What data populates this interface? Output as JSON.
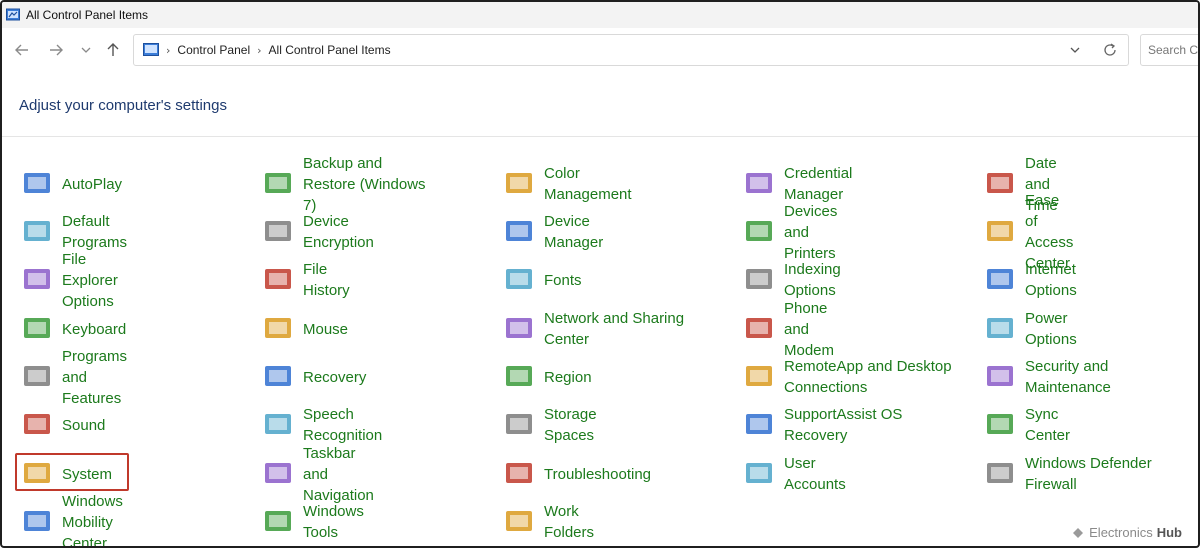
{
  "window": {
    "title": "All Control Panel Items"
  },
  "address": {
    "crumbs": [
      "Control Panel",
      "All Control Panel Items"
    ],
    "search_placeholder": "Search Co"
  },
  "heading": "Adjust your computer's settings",
  "items": [
    {
      "label": "AutoPlay",
      "icon": "autoplay-icon"
    },
    {
      "label": "Backup and Restore (Windows 7)",
      "icon": "backup-icon"
    },
    {
      "label": "Color Management",
      "icon": "color-management-icon"
    },
    {
      "label": "Credential Manager",
      "icon": "credential-manager-icon"
    },
    {
      "label": "Date and Time",
      "icon": "date-time-icon"
    },
    {
      "label": "Default Programs",
      "icon": "default-programs-icon"
    },
    {
      "label": "Device Encryption",
      "icon": "device-encryption-icon"
    },
    {
      "label": "Device Manager",
      "icon": "device-manager-icon"
    },
    {
      "label": "Devices and Printers",
      "icon": "printer-icon"
    },
    {
      "label": "Ease of Access Center",
      "icon": "ease-of-access-icon"
    },
    {
      "label": "File Explorer Options",
      "icon": "folder-options-icon"
    },
    {
      "label": "File History",
      "icon": "file-history-icon"
    },
    {
      "label": "Fonts",
      "icon": "fonts-icon"
    },
    {
      "label": "Indexing Options",
      "icon": "indexing-icon"
    },
    {
      "label": "Internet Options",
      "icon": "internet-options-icon"
    },
    {
      "label": "Keyboard",
      "icon": "keyboard-icon"
    },
    {
      "label": "Mouse",
      "icon": "mouse-icon"
    },
    {
      "label": "Network and Sharing Center",
      "icon": "network-icon"
    },
    {
      "label": "Phone and Modem",
      "icon": "phone-icon"
    },
    {
      "label": "Power Options",
      "icon": "power-icon"
    },
    {
      "label": "Programs and Features",
      "icon": "programs-icon"
    },
    {
      "label": "Recovery",
      "icon": "recovery-icon"
    },
    {
      "label": "Region",
      "icon": "region-icon"
    },
    {
      "label": "RemoteApp and Desktop Connections",
      "icon": "remoteapp-icon"
    },
    {
      "label": "Security and Maintenance",
      "icon": "security-flag-icon"
    },
    {
      "label": "Sound",
      "icon": "speaker-icon"
    },
    {
      "label": "Speech Recognition",
      "icon": "microphone-icon"
    },
    {
      "label": "Storage Spaces",
      "icon": "storage-icon"
    },
    {
      "label": "SupportAssist OS Recovery",
      "icon": "supportassist-icon"
    },
    {
      "label": "Sync Center",
      "icon": "sync-icon"
    },
    {
      "label": "System",
      "icon": "system-monitor-icon"
    },
    {
      "label": "Taskbar and Navigation",
      "icon": "taskbar-icon"
    },
    {
      "label": "Troubleshooting",
      "icon": "troubleshooting-icon"
    },
    {
      "label": "User Accounts",
      "icon": "users-icon"
    },
    {
      "label": "Windows Defender Firewall",
      "icon": "firewall-icon"
    },
    {
      "label": "Windows Mobility Center",
      "icon": "mobility-icon"
    },
    {
      "label": "Windows Tools",
      "icon": "tools-gear-icon"
    },
    {
      "label": "Work Folders",
      "icon": "work-folders-icon"
    }
  ],
  "watermark": {
    "text_a": "Electronics",
    "text_b": "Hub"
  },
  "colors": {
    "link_green": "#1c7a1c",
    "heading_blue": "#1e3a6e",
    "highlight_red": "#c0392b"
  }
}
